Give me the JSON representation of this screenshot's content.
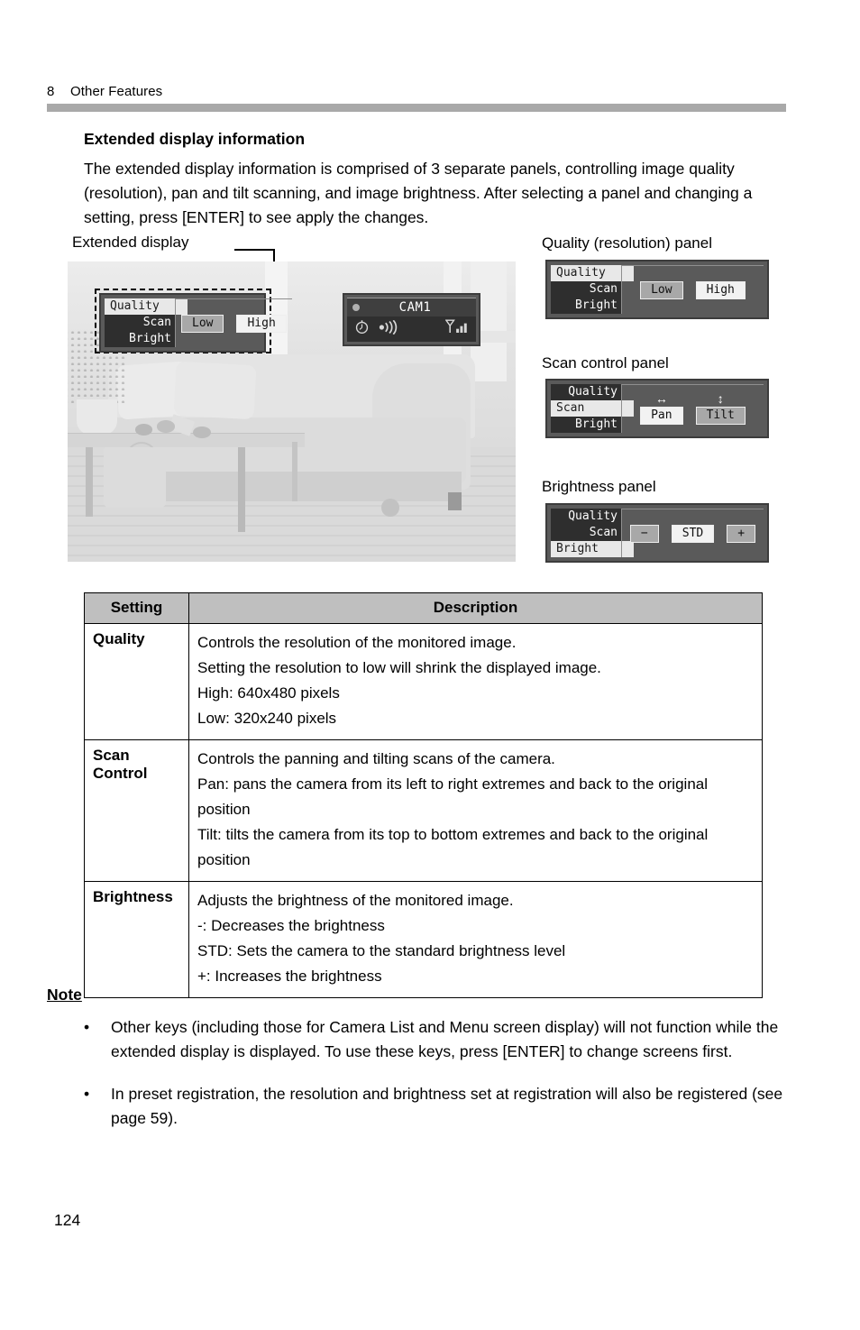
{
  "header": {
    "chapter_number": "8",
    "chapter_title": "Other Features"
  },
  "section": {
    "title": "Extended display information",
    "intro": "The extended display information is comprised of 3 separate panels, controlling image quality (resolution), pan and tilt scanning, and image brightness. After selecting a panel and changing a setting, press [ENTER] to see apply the changes."
  },
  "figure": {
    "left_caption": "Extended display",
    "overlay_panel": {
      "tabs": [
        "Quality",
        "Scan",
        "Bright"
      ],
      "selected_tab": "Quality",
      "buttons": [
        "Low",
        "High"
      ],
      "active_button": "High"
    },
    "camera_status": {
      "name": "CAM1",
      "icons": [
        "timer-icon",
        "audio-icon",
        "signal-icon"
      ]
    }
  },
  "panels": [
    {
      "caption": "Quality (resolution) panel",
      "tabs": [
        "Quality",
        "Scan",
        "Bright"
      ],
      "selected_tab": "Quality",
      "buttons": [
        {
          "label": "Low",
          "active": false,
          "arrow": ""
        },
        {
          "label": "High",
          "active": true,
          "arrow": ""
        }
      ]
    },
    {
      "caption": "Scan control panel",
      "tabs": [
        "Quality",
        "Scan",
        "Bright"
      ],
      "selected_tab": "Scan",
      "buttons": [
        {
          "label": "Pan",
          "active": true,
          "arrow": "↔"
        },
        {
          "label": "Tilt",
          "active": false,
          "arrow": "↕"
        }
      ]
    },
    {
      "caption": "Brightness panel",
      "tabs": [
        "Quality",
        "Scan",
        "Bright"
      ],
      "selected_tab": "Bright",
      "buttons": [
        {
          "label": "−",
          "active": false,
          "arrow": ""
        },
        {
          "label": "STD",
          "active": true,
          "arrow": ""
        },
        {
          "label": "+",
          "active": false,
          "arrow": ""
        }
      ]
    }
  ],
  "table": {
    "headers": [
      "Setting",
      "Description"
    ],
    "rows": [
      {
        "setting": "Quality",
        "lines": [
          "Controls the resolution of the monitored image.",
          "Setting the resolution to low will shrink the displayed image.",
          "High: 640x480 pixels",
          "Low: 320x240 pixels"
        ]
      },
      {
        "setting": "Scan Control",
        "lines": [
          "Controls the panning and tilting scans of the camera.",
          "Pan: pans the camera from its left to right extremes and back to the original position",
          "Tilt: tilts the camera from its top to bottom extremes and back to the original position"
        ]
      },
      {
        "setting": "Brightness",
        "lines": [
          "Adjusts the brightness of the monitored image.",
          "-: Decreases the brightness",
          "STD: Sets the camera to the standard brightness level",
          "+: Increases the brightness"
        ]
      }
    ]
  },
  "note": {
    "title": "Note",
    "bullet": "•",
    "items": [
      "Other keys (including those for Camera List and Menu screen display) will not function while the extended display is displayed. To use these keys, press [ENTER] to change screens first.",
      "In preset registration, the resolution and brightness set at registration will also be registered (see page 59)."
    ]
  },
  "footer": {
    "page_number": "124"
  },
  "colors": {
    "header_rule": "#a9a9a9",
    "table_header_bg": "#bfbfbf",
    "osd_bg": "#5a5a5a",
    "osd_tab_bg": "#2e2e2e",
    "osd_button_bg": "#a8a8a8",
    "osd_button_active_bg": "#f2f2f2"
  }
}
